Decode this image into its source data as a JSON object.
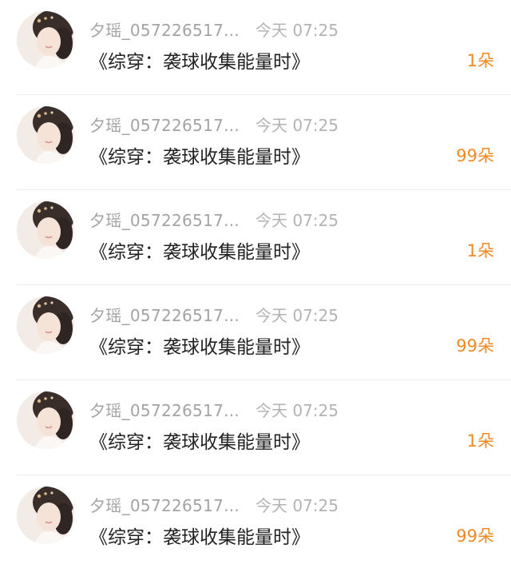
{
  "theme": {
    "accent": "#f08a24",
    "muted_text": "#a3a3a3",
    "primary_text": "#222222"
  },
  "rows": [
    {
      "avatar": "user-avatar-photo",
      "username": "夕瑶_057226517...",
      "time": "今天 07:25",
      "title": "《综穿：袭球收集能量时》",
      "count": "1朵"
    },
    {
      "avatar": "user-avatar-photo",
      "username": "夕瑶_057226517...",
      "time": "今天 07:25",
      "title": "《综穿：袭球收集能量时》",
      "count": "99朵"
    },
    {
      "avatar": "user-avatar-photo",
      "username": "夕瑶_057226517...",
      "time": "今天 07:25",
      "title": "《综穿：袭球收集能量时》",
      "count": "1朵"
    },
    {
      "avatar": "user-avatar-photo",
      "username": "夕瑶_057226517...",
      "time": "今天 07:25",
      "title": "《综穿：袭球收集能量时》",
      "count": "99朵"
    },
    {
      "avatar": "user-avatar-photo",
      "username": "夕瑶_057226517...",
      "time": "今天 07:25",
      "title": "《综穿：袭球收集能量时》",
      "count": "1朵"
    },
    {
      "avatar": "user-avatar-photo",
      "username": "夕瑶_057226517...",
      "time": "今天 07:25",
      "title": "《综穿：袭球收集能量时》",
      "count": "99朵"
    }
  ]
}
